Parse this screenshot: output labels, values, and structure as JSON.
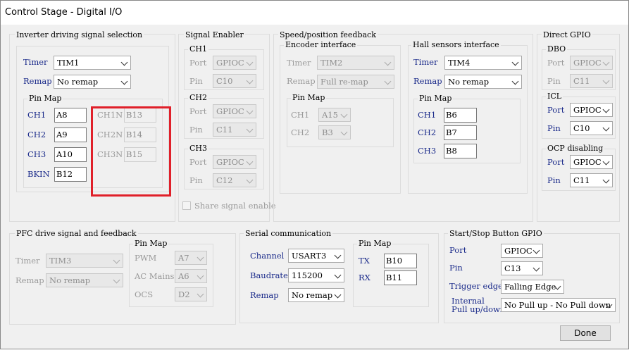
{
  "window": {
    "title": "Control Stage - Digital I/O",
    "done_label": "Done"
  },
  "inverter": {
    "title": "Inverter driving signal selection",
    "timer_label": "Timer",
    "timer_value": "TIM1",
    "remap_label": "Remap",
    "remap_value": "No remap",
    "pinmap_title": "Pin Map",
    "pins": [
      {
        "label": "CH1",
        "value": "A8"
      },
      {
        "label": "CH2",
        "value": "A9"
      },
      {
        "label": "CH3",
        "value": "A10"
      },
      {
        "label": "BKIN",
        "value": "B12"
      }
    ],
    "npins": [
      {
        "label": "CH1N",
        "value": "B13"
      },
      {
        "label": "CH2N",
        "value": "B14"
      },
      {
        "label": "CH3N",
        "value": "B15"
      }
    ]
  },
  "signal_enabler": {
    "title": "Signal Enabler",
    "port_label": "Port",
    "pin_label": "Pin",
    "channels": [
      {
        "name": "CH1",
        "port": "GPIOC",
        "pin": "C10"
      },
      {
        "name": "CH2",
        "port": "GPIOC",
        "pin": "C11"
      },
      {
        "name": "CH3",
        "port": "GPIOC",
        "pin": "C12"
      }
    ],
    "share_label": "Share signal enable"
  },
  "speed_feedback": {
    "title": "Speed/position feedback",
    "encoder": {
      "title": "Encoder interface",
      "timer_label": "Timer",
      "timer_value": "TIM2",
      "remap_label": "Remap",
      "remap_value": "Full re-map",
      "pinmap_title": "Pin Map",
      "pins": [
        {
          "label": "CH1",
          "value": "A15"
        },
        {
          "label": "CH2",
          "value": "B3"
        }
      ]
    },
    "hall": {
      "title": "Hall sensors interface",
      "timer_label": "Timer",
      "timer_value": "TIM4",
      "remap_label": "Remap",
      "remap_value": "No remap",
      "pinmap_title": "Pin Map",
      "pins": [
        {
          "label": "CH1",
          "value": "B6"
        },
        {
          "label": "CH2",
          "value": "B7"
        },
        {
          "label": "CH3",
          "value": "B8"
        }
      ]
    }
  },
  "direct_gpio": {
    "title": "Direct GPIO",
    "dbo": {
      "title": "DBO",
      "port_label": "Port",
      "port": "GPIOC",
      "pin_label": "Pin",
      "pin": "C11"
    },
    "icl": {
      "title": "ICL",
      "port_label": "Port",
      "port": "GPIOC",
      "pin_label": "Pin",
      "pin": "C10"
    },
    "ocp": {
      "title": "OCP disabling",
      "port_label": "Port",
      "port": "GPIOC",
      "pin_label": "Pin",
      "pin": "C11"
    }
  },
  "pfc": {
    "title": "PFC drive signal and feedback",
    "timer_label": "Timer",
    "timer_value": "TIM3",
    "remap_label": "Remap",
    "remap_value": "No remap",
    "pinmap_title": "Pin Map",
    "pins": [
      {
        "label": "PWM",
        "value": "A7"
      },
      {
        "label": "AC Mains",
        "value": "A6"
      },
      {
        "label": "OCS",
        "value": "D2"
      }
    ]
  },
  "serial": {
    "title": "Serial communication",
    "channel_label": "Channel",
    "channel_value": "USART3",
    "baud_label": "Baudrate",
    "baud_value": "115200",
    "remap_label": "Remap",
    "remap_value": "No remap",
    "pinmap_title": "Pin Map",
    "tx_label": "TX",
    "tx_value": "B10",
    "rx_label": "RX",
    "rx_value": "B11"
  },
  "startstop": {
    "title": "Start/Stop Button GPIO",
    "port_label": "Port",
    "port_value": "GPIOC",
    "pin_label": "Pin",
    "pin_value": "C13",
    "trigger_label": "Trigger edge",
    "trigger_value": "Falling Edge",
    "pull_label_1": "Internal",
    "pull_label_2": "Pull up/down",
    "pull_value": "No Pull up - No Pull down"
  }
}
